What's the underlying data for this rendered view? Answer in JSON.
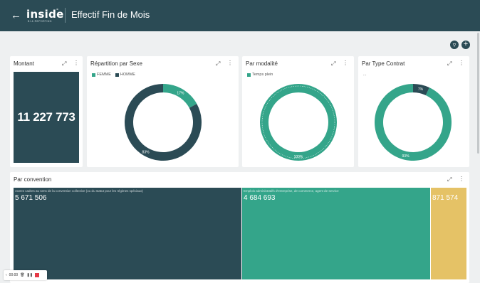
{
  "header": {
    "back_icon": "arrow-left-icon",
    "logo_text": "inside",
    "logo_tagline": "BI & REPORTING",
    "title": "Effectif Fin de Mois"
  },
  "toolbar": {
    "filter_icon": "filter-icon",
    "add_icon": "plus-icon"
  },
  "cards": {
    "montant": {
      "title": "Montant",
      "value": "11 227 773"
    },
    "sexe": {
      "title": "Répartition par Sexe",
      "legend": [
        {
          "label": "FEMME",
          "color": "#34a58a"
        },
        {
          "label": "HOMME",
          "color": "#2b4b55"
        }
      ]
    },
    "modalite": {
      "title": "Par modalité",
      "legend": [
        {
          "label": "Temps plein",
          "color": "#34a58a"
        }
      ]
    },
    "contrat": {
      "title": "Par Type Contrat",
      "legend_more": "..."
    },
    "convention": {
      "title": "Par convention"
    }
  },
  "chart_data": [
    {
      "type": "pie",
      "title": "Répartition par Sexe",
      "categories": [
        "FEMME",
        "HOMME"
      ],
      "values": [
        17,
        83
      ],
      "labels": [
        "17%",
        "83%"
      ],
      "colors": [
        "#34a58a",
        "#2b4b55"
      ]
    },
    {
      "type": "pie",
      "title": "Par modalité",
      "categories": [
        "Temps plein"
      ],
      "values": [
        100
      ],
      "labels": [
        "100%"
      ],
      "colors": [
        "#34a58a"
      ]
    },
    {
      "type": "pie",
      "title": "Par Type Contrat",
      "categories": [
        "",
        ""
      ],
      "values": [
        7,
        93
      ],
      "labels": [
        "7%",
        "93%"
      ],
      "colors": [
        "#2b4b55",
        "#34a58a"
      ]
    },
    {
      "type": "treemap",
      "title": "Par convention",
      "items": [
        {
          "label": "Autres cadres au sens de la convention collective (ou du statut pour les régimes spéciaux)",
          "value": 5671506,
          "display": "5 671 506",
          "color": "#2b4b55"
        },
        {
          "label": "Emplois administratifs d'entreprise, de commerce, agent de service",
          "value": 4684693,
          "display": "4 684 693",
          "color": "#34a58a"
        },
        {
          "label": "",
          "value": 871574,
          "display": "871 574",
          "color": "#e5c266"
        }
      ]
    }
  ],
  "recorder": {
    "time": "00:00",
    "icons": [
      "chevron-left-icon",
      "trash-icon",
      "pause-icon",
      "stop-icon"
    ]
  }
}
